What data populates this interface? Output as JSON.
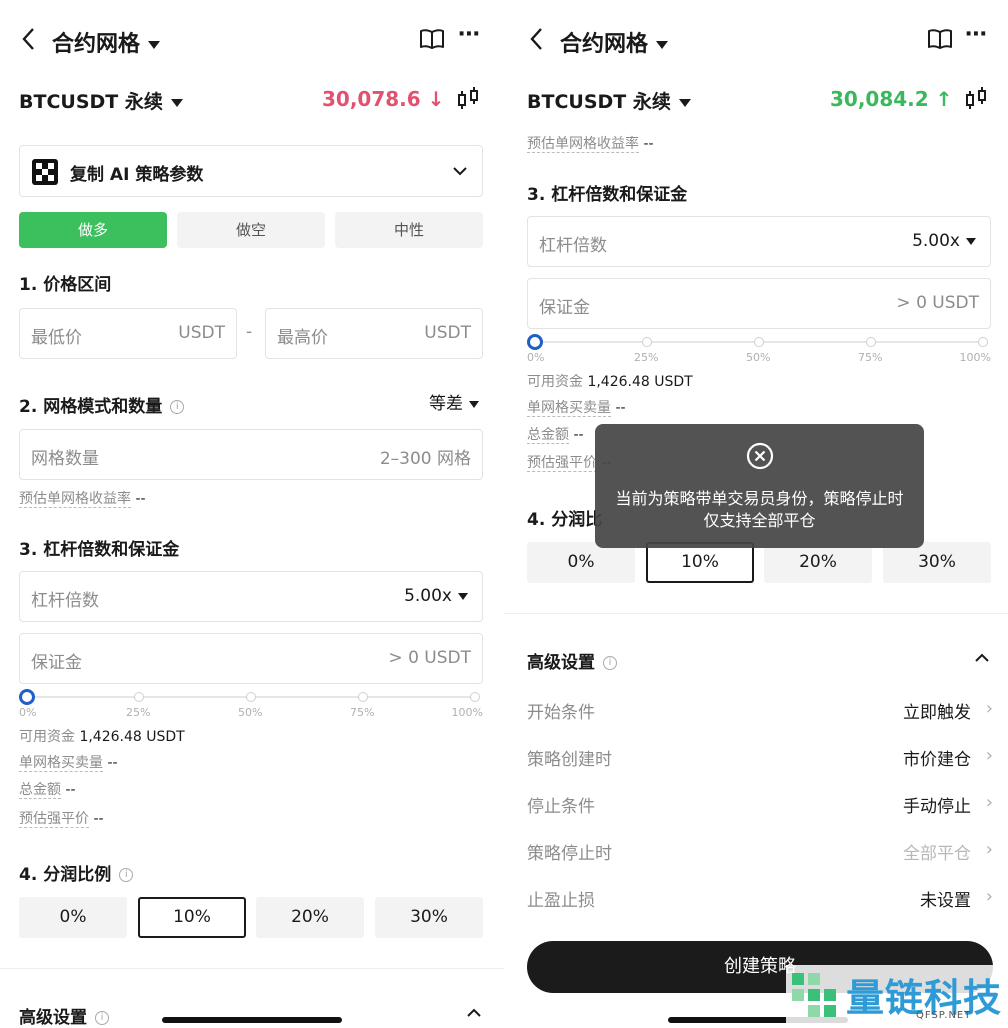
{
  "left": {
    "nav": {
      "title": "合约网格"
    },
    "ticker": {
      "pair": "BTCUSDT 永续",
      "price": "30,078.6",
      "arrow": "↓",
      "price_color": "#e0526f"
    },
    "copy_ai": {
      "label": "复制 AI 策略参数"
    },
    "direction": {
      "long": "做多",
      "short": "做空",
      "neutral": "中性"
    },
    "price_range": {
      "title": "1. 价格区间",
      "min_placeholder": "最低价",
      "min_unit": "USDT",
      "sep": "-",
      "max_placeholder": "最高价",
      "max_unit": "USDT"
    },
    "grid_mode": {
      "title": "2. 网格模式和数量",
      "mode": "等差",
      "count_placeholder": "网格数量",
      "count_hint": "2–300 网格",
      "yield_label": "预估单网格收益率",
      "yield_value": "--"
    },
    "leverage": {
      "title": "3. 杠杆倍数和保证金",
      "label": "杠杆倍数",
      "value": "5.00x",
      "margin_label": "保证金",
      "margin_hint": "> 0 USDT",
      "ticks": [
        "0%",
        "25%",
        "50%",
        "75%",
        "100%"
      ],
      "available_label": "可用资金",
      "available_value": "1,426.48 USDT",
      "qty_label": "单网格买卖量",
      "qty_value": "--",
      "total_label": "总金额",
      "total_value": "--",
      "liq_label": "预估强平价",
      "liq_value": "--",
      "slider_fraction": 0
    },
    "profit_share": {
      "title": "4. 分润比例",
      "options": [
        "0%",
        "10%",
        "20%",
        "30%"
      ],
      "selected": 1
    },
    "advanced": {
      "title": "高级设置"
    }
  },
  "right": {
    "nav": {
      "title": "合约网格"
    },
    "ticker": {
      "pair": "BTCUSDT 永续",
      "price": "30,084.2",
      "arrow": "↑",
      "price_color": "#3bb85d"
    },
    "yield_label": "预估单网格收益率",
    "yield_value": "--",
    "leverage": {
      "title": "3. 杠杆倍数和保证金",
      "label": "杠杆倍数",
      "value": "5.00x",
      "margin_label": "保证金",
      "margin_hint": "> 0 USDT",
      "ticks": [
        "0%",
        "25%",
        "50%",
        "75%",
        "100%"
      ],
      "available_label": "可用资金",
      "available_value": "1,426.48 USDT",
      "qty_label": "单网格买卖量",
      "qty_value": "--",
      "total_label": "总金额",
      "total_value": "--",
      "liq_label": "预估强平价",
      "liq_value": "--",
      "slider_fraction": 0
    },
    "profit_share": {
      "title": "4. 分润比",
      "options": [
        "0%",
        "10%",
        "20%",
        "30%"
      ],
      "selected": 1
    },
    "toast": {
      "message": "当前为策略带单交易员身份，策略停止时仅支持全部平仓"
    },
    "advanced": {
      "title": "高级设置",
      "rows": [
        {
          "label": "开始条件",
          "value": "立即触发"
        },
        {
          "label": "策略创建时",
          "value": "市价建仓"
        },
        {
          "label": "停止条件",
          "value": "手动停止"
        },
        {
          "label": "策略停止时",
          "value": "全部平仓"
        },
        {
          "label": "止盈止损",
          "value": "未设置"
        }
      ]
    },
    "create_button": {
      "label": "创建策略"
    },
    "watermark": {
      "brand": "量链科技",
      "domain": "QFSP.NET"
    }
  }
}
